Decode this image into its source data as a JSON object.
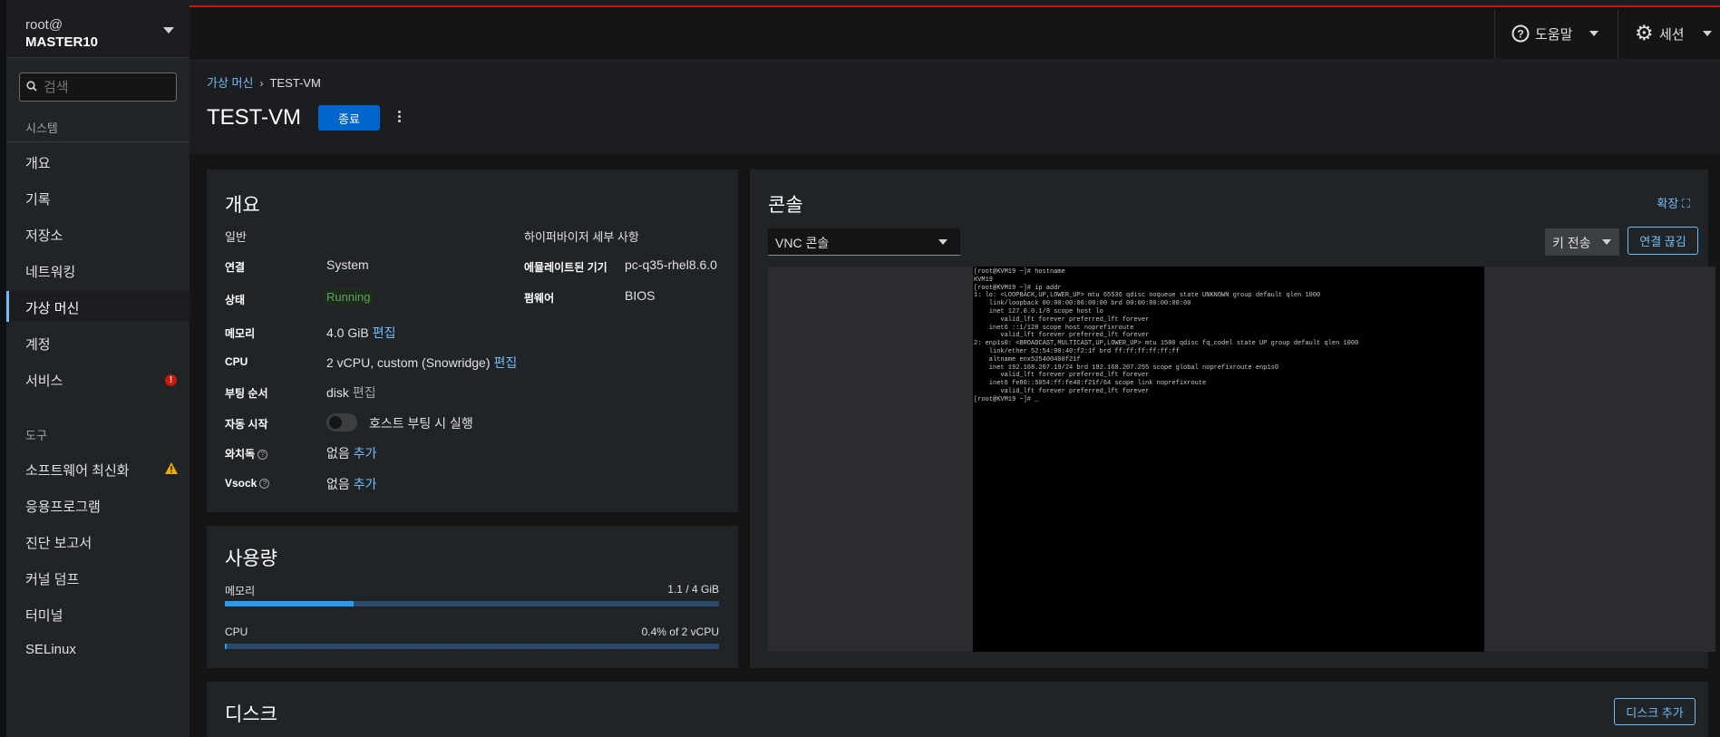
{
  "host": {
    "user": "root@",
    "name": "MASTER10"
  },
  "search": {
    "placeholder": "검색"
  },
  "sidebar": {
    "section_system": "시스템",
    "system_items": [
      {
        "label": "개요"
      },
      {
        "label": "기록"
      },
      {
        "label": "저장소"
      },
      {
        "label": "네트워킹"
      },
      {
        "label": "가상 머신",
        "active": true
      },
      {
        "label": "계정"
      },
      {
        "label": "서비스",
        "badge": "!"
      }
    ],
    "section_tools": "도구",
    "tool_items": [
      {
        "label": "소프트웨어 최신화",
        "badge": "warning"
      },
      {
        "label": "응용프로그램"
      },
      {
        "label": "진단 보고서"
      },
      {
        "label": "커널 덤프"
      },
      {
        "label": "터미널"
      },
      {
        "label": "SELinux"
      }
    ]
  },
  "masthead": {
    "help_label": "도움말",
    "session_label": "세션"
  },
  "breadcrumb": {
    "parent": "가상 머신",
    "current": "TEST-VM"
  },
  "vm": {
    "name": "TEST-VM",
    "shutdown_label": "종료"
  },
  "overview": {
    "title": "개요",
    "general_heading": "일반",
    "hypervisor_heading": "하이퍼바이저 세부 사항",
    "connection": {
      "label": "연결",
      "value": "System"
    },
    "state": {
      "label": "상태",
      "value": "Running"
    },
    "memory": {
      "label": "메모리",
      "value": "4.0 GiB",
      "action": "편집"
    },
    "cpu": {
      "label": "CPU",
      "value": "2 vCPU, custom (Snowridge)",
      "action": "편집"
    },
    "boot_order": {
      "label": "부팅 순서",
      "value": "disk",
      "action": "편집"
    },
    "autostart": {
      "label": "자동 시작",
      "value": "호스트 부팅 시 실행",
      "on": false
    },
    "watchdog": {
      "label": "와치독",
      "value": "없음",
      "action": "추가"
    },
    "vsock": {
      "label": "Vsock",
      "value": "없음",
      "action": "추가"
    },
    "emulated_machine": {
      "label": "에뮬레이트된 기기",
      "value": "pc-q35-rhel8.6.0"
    },
    "firmware": {
      "label": "펌웨어",
      "value": "BIOS"
    }
  },
  "usage": {
    "title": "사용량",
    "memory": {
      "label": "메모리",
      "value_text": "1.1 / 4 GiB",
      "fraction": 0.26
    },
    "cpu": {
      "label": "CPU",
      "value_text": "0.4% of 2 vCPU",
      "fraction": 0.004
    }
  },
  "console": {
    "title": "콘솔",
    "expand_label": "확장",
    "type_selected": "VNC 콘솔",
    "send_key_label": "키 전송",
    "disconnect_label": "연결 끊김",
    "terminal_lines": [
      "[root@KVM19 ~]# hostname",
      "KVM19",
      "[root@KVM19 ~]# ip addr",
      "1: lo: <LOOPBACK,UP,LOWER_UP> mtu 65536 qdisc noqueue state UNKNOWN group default qlen 1000",
      "    link/loopback 00:00:00:00:00:00 brd 00:00:00:00:00:00",
      "    inet 127.0.0.1/8 scope host lo",
      "       valid_lft forever preferred_lft forever",
      "    inet6 ::1/128 scope host noprefixroute",
      "       valid_lft forever preferred_lft forever",
      "2: enp1s0: <BROADCAST,MULTICAST,UP,LOWER_UP> mtu 1500 qdisc fq_codel state UP group default qlen 1000",
      "    link/ether 52:54:00:40:f2:1f brd ff:ff:ff:ff:ff:ff",
      "    altname enx525400400f21f",
      "    inet 192.168.207.19/24 brd 192.168.207.255 scope global noprefixroute enp1s0",
      "       valid_lft forever preferred_lft forever",
      "    inet6 fe80::5054:ff:fe40:f21f/64 scope link noprefixroute",
      "       valid_lft forever preferred_lft forever",
      "[root@KVM19 ~]# _"
    ]
  },
  "disks": {
    "title": "디스크",
    "add_label": "디스크 추가"
  }
}
